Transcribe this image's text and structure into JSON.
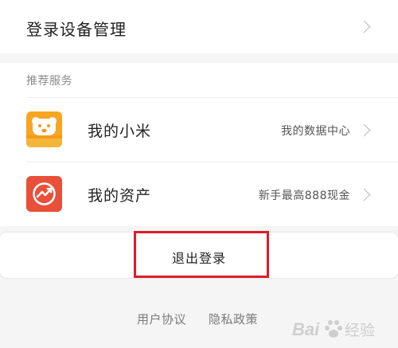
{
  "device_management": {
    "title": "登录设备管理"
  },
  "services": {
    "section_title": "推荐服务",
    "items": [
      {
        "label": "我的小米",
        "detail": "我的数据中心",
        "icon": "xiaomi-bear-icon",
        "color": "#f6a623"
      },
      {
        "label": "我的资产",
        "detail": "新手最高888现金",
        "icon": "assets-chart-icon",
        "color": "#e8503a"
      }
    ]
  },
  "logout": {
    "label": "退出登录",
    "highlight_color": "#e01b2b"
  },
  "footer": {
    "user_agreement": "用户协议",
    "privacy_policy": "隐私政策"
  },
  "watermark": {
    "text": "Bai 经验"
  }
}
